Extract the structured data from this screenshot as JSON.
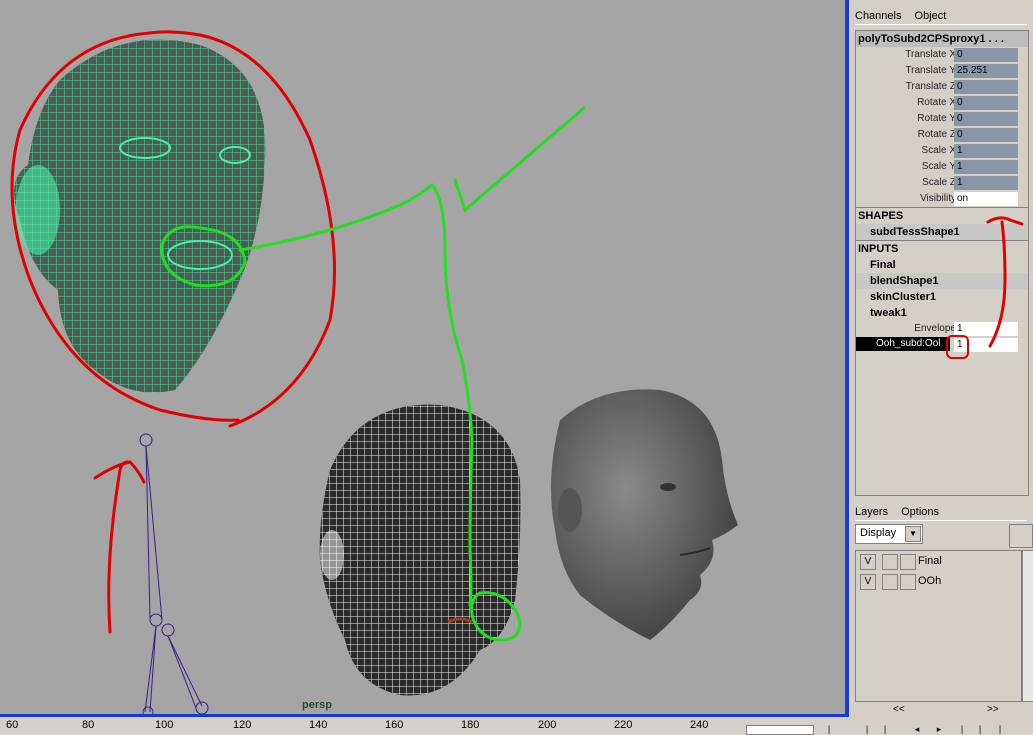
{
  "viewport": {
    "label": "persp"
  },
  "timeline": {
    "ticks": [
      "60",
      "80",
      "100",
      "120",
      "140",
      "160",
      "180",
      "200",
      "220",
      "240"
    ]
  },
  "channel_box": {
    "menu": [
      "Channels",
      "Object"
    ],
    "node": "polyToSubd2CPSproxy1 . . .",
    "attributes": [
      {
        "label": "Translate X",
        "value": "0"
      },
      {
        "label": "Translate Y",
        "value": "25.251"
      },
      {
        "label": "Translate Z",
        "value": "0"
      },
      {
        "label": "Rotate X",
        "value": "0"
      },
      {
        "label": "Rotate Y",
        "value": "0"
      },
      {
        "label": "Rotate Z",
        "value": "0"
      },
      {
        "label": "Scale X",
        "value": "1"
      },
      {
        "label": "Scale Y",
        "value": "1"
      },
      {
        "label": "Scale Z",
        "value": "1"
      },
      {
        "label": "Visibility",
        "value": "on"
      }
    ],
    "shapes_header": "SHAPES",
    "shape": "subdTessShape1",
    "inputs_header": "INPUTS",
    "inputs": [
      "Final",
      "blendShape1",
      "skinCluster1",
      "tweak1"
    ],
    "envelope_label": "Envelope",
    "envelope_value": "1",
    "target_label": "Ooh_subd:Ool",
    "target_value": "1"
  },
  "layers": {
    "menu": [
      "Layers",
      "Options"
    ],
    "display": "Display",
    "items": [
      {
        "v": "V",
        "name": "Final"
      },
      {
        "v": "V",
        "name": "OOh"
      }
    ],
    "prev": "<<",
    "next": ">>"
  },
  "colors": {
    "viewport_bg": "#a5a5a5",
    "panel_bg": "#d4d0c8",
    "annotation_red": "#e00000",
    "annotation_green": "#22dd22",
    "wire_green": "#3cf0a0"
  }
}
